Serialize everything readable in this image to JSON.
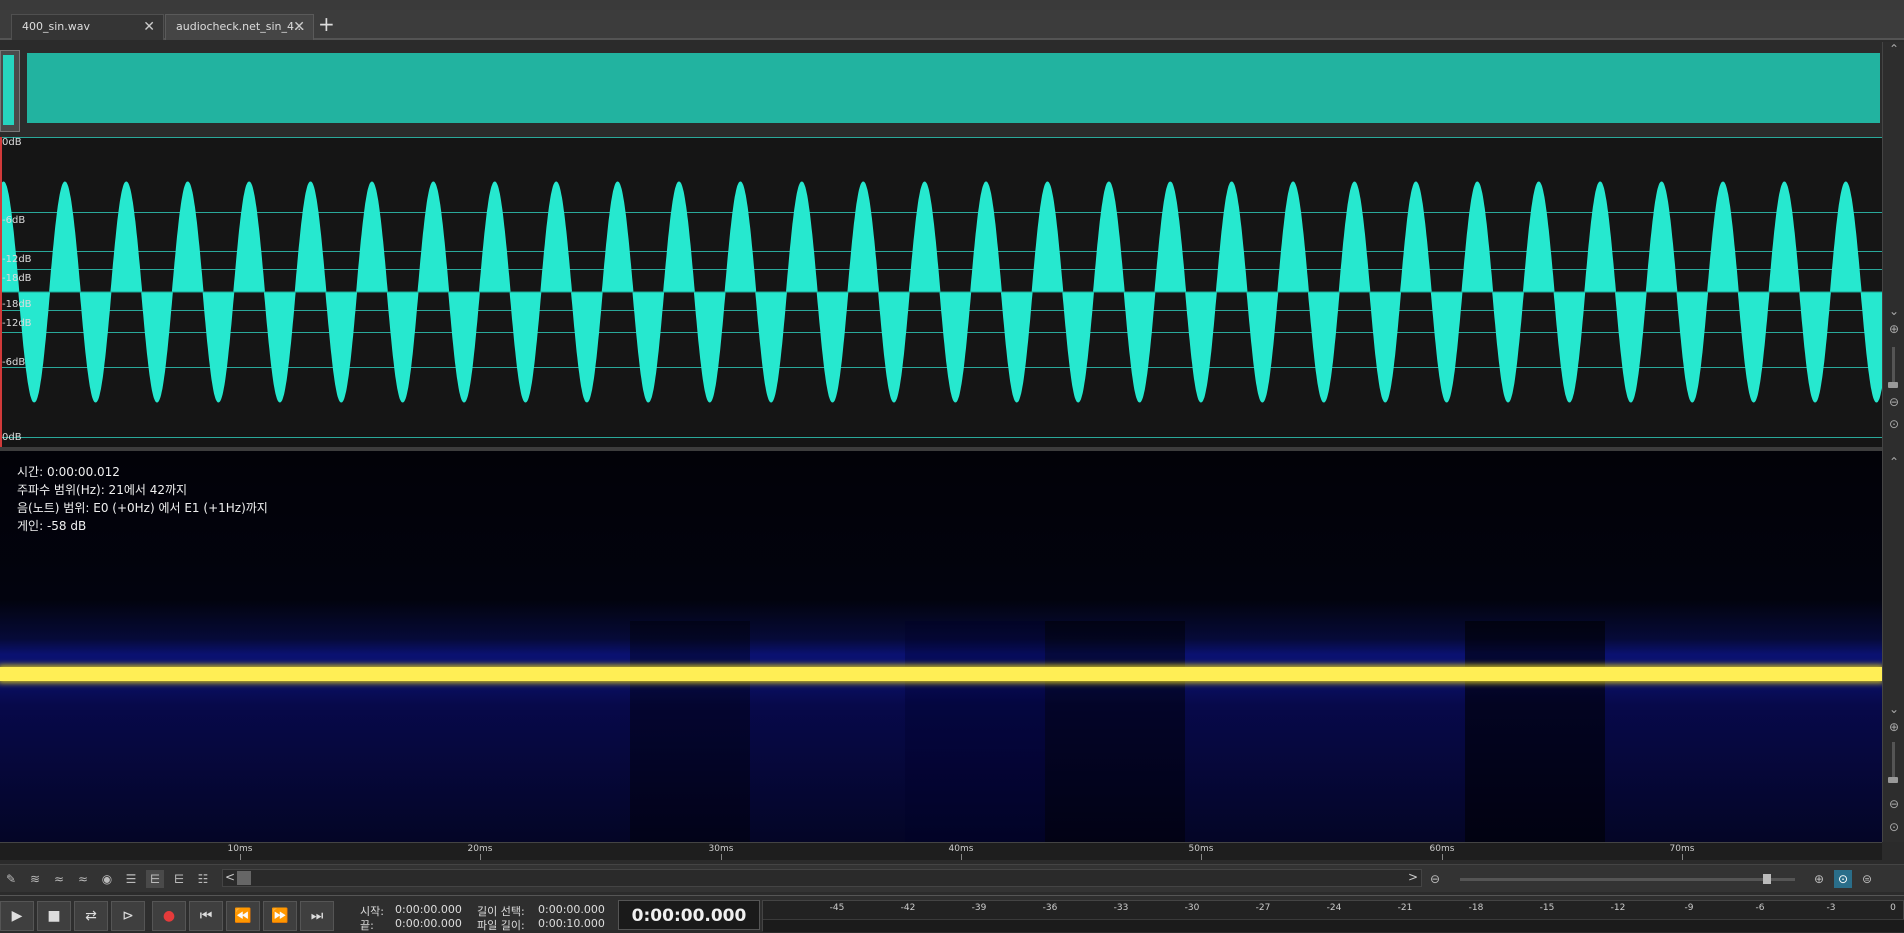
{
  "tabs": [
    {
      "label": "400_sin.wav",
      "close": "✕"
    },
    {
      "label": "audiocheck.net_sin_4...",
      "close": "✕"
    }
  ],
  "tab_add": "+",
  "waveform": {
    "color": "#26e8cf",
    "db_labels_top": [
      "0dB",
      "-6dB",
      "-12dB",
      "-18dB"
    ],
    "db_labels_bottom": [
      "-18dB",
      "-12dB",
      "-6dB",
      "0dB"
    ],
    "cycles": 31
  },
  "spectrogram": {
    "info": {
      "time": "시간: 0:00:00.012",
      "freq_range": "주파수 범위(Hz): 21에서 42까지",
      "note_range": "음(노트) 범위: E0 (+0Hz) 에서 E1 (+1Hz)까지",
      "gain": "게인: -58 dB"
    },
    "line_color": "#ffee55"
  },
  "ruler": {
    "ticks": [
      "10ms",
      "20ms",
      "30ms",
      "40ms",
      "50ms",
      "60ms",
      "70ms"
    ]
  },
  "toolbar": {
    "icons": [
      "pencil-icon",
      "waveform-icon",
      "waveform-dim-icon",
      "waveform-dim2-icon",
      "snapshot-icon",
      "stack-icon",
      "spectral-icon",
      "spectral2-icon",
      "list-icon"
    ],
    "scroll_left": "<",
    "scroll_right": ">"
  },
  "transport": {
    "buttons": [
      "play",
      "stop",
      "loop",
      "play-from",
      "record",
      "go-start",
      "rewind",
      "fast-forward",
      "go-end"
    ],
    "start_label": "시작:",
    "start_value": "0:00:00.000",
    "end_label": "끝:",
    "end_value": "0:00:00.000",
    "sel_length_label": "길이 선택:",
    "sel_length_value": "0:00:00.000",
    "file_length_label": "파일 길이:",
    "file_length_value": "0:00:10.000",
    "timecode": "0:00:00.000"
  },
  "meter": {
    "ticks": [
      "-45",
      "-42",
      "-39",
      "-36",
      "-33",
      "-30",
      "-27",
      "-24",
      "-21",
      "-18",
      "-15",
      "-12",
      "-9",
      "-6",
      "-3",
      "0"
    ]
  }
}
